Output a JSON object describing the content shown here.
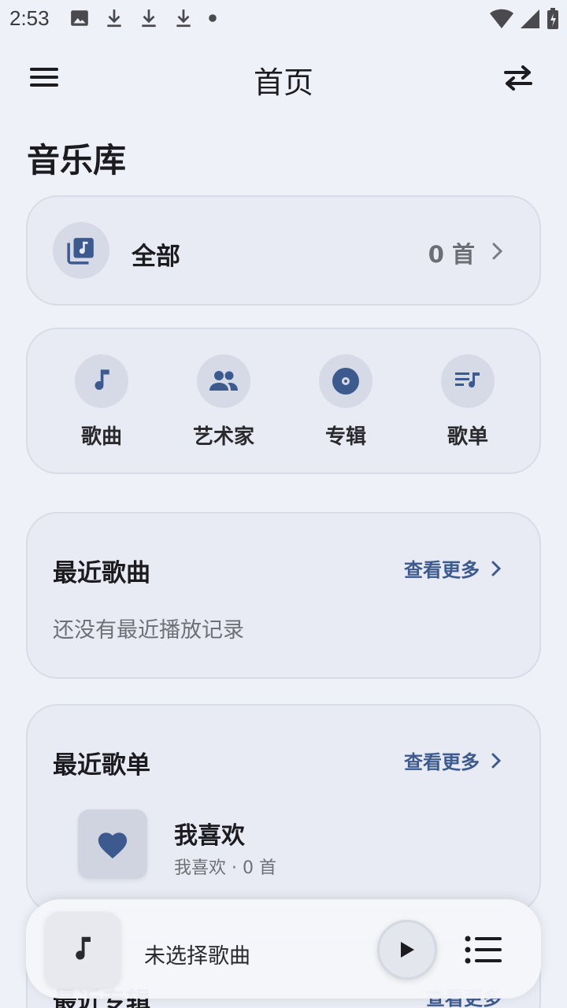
{
  "status_bar": {
    "time": "2:53"
  },
  "app_bar": {
    "title": "首页"
  },
  "section_title": "音乐库",
  "all_card": {
    "label": "全部",
    "count": "0 首"
  },
  "categories": [
    {
      "label": "歌曲",
      "icon": "music-note-icon"
    },
    {
      "label": "艺术家",
      "icon": "people-icon"
    },
    {
      "label": "专辑",
      "icon": "disc-icon"
    },
    {
      "label": "歌单",
      "icon": "playlist-icon"
    }
  ],
  "recent_songs": {
    "title": "最近歌曲",
    "more": "查看更多",
    "empty": "还没有最近播放记录"
  },
  "recent_playlists": {
    "title": "最近歌单",
    "more": "查看更多",
    "items": [
      {
        "name": "我喜欢",
        "sub": "我喜欢 · 0 首"
      }
    ]
  },
  "recent_albums": {
    "title": "最近专辑",
    "more": "查看更多"
  },
  "mini_player": {
    "title": "未选择歌曲"
  },
  "colors": {
    "accent": "#3d5a8f",
    "background": "#eef1f8",
    "card": "#e8ebf3"
  }
}
